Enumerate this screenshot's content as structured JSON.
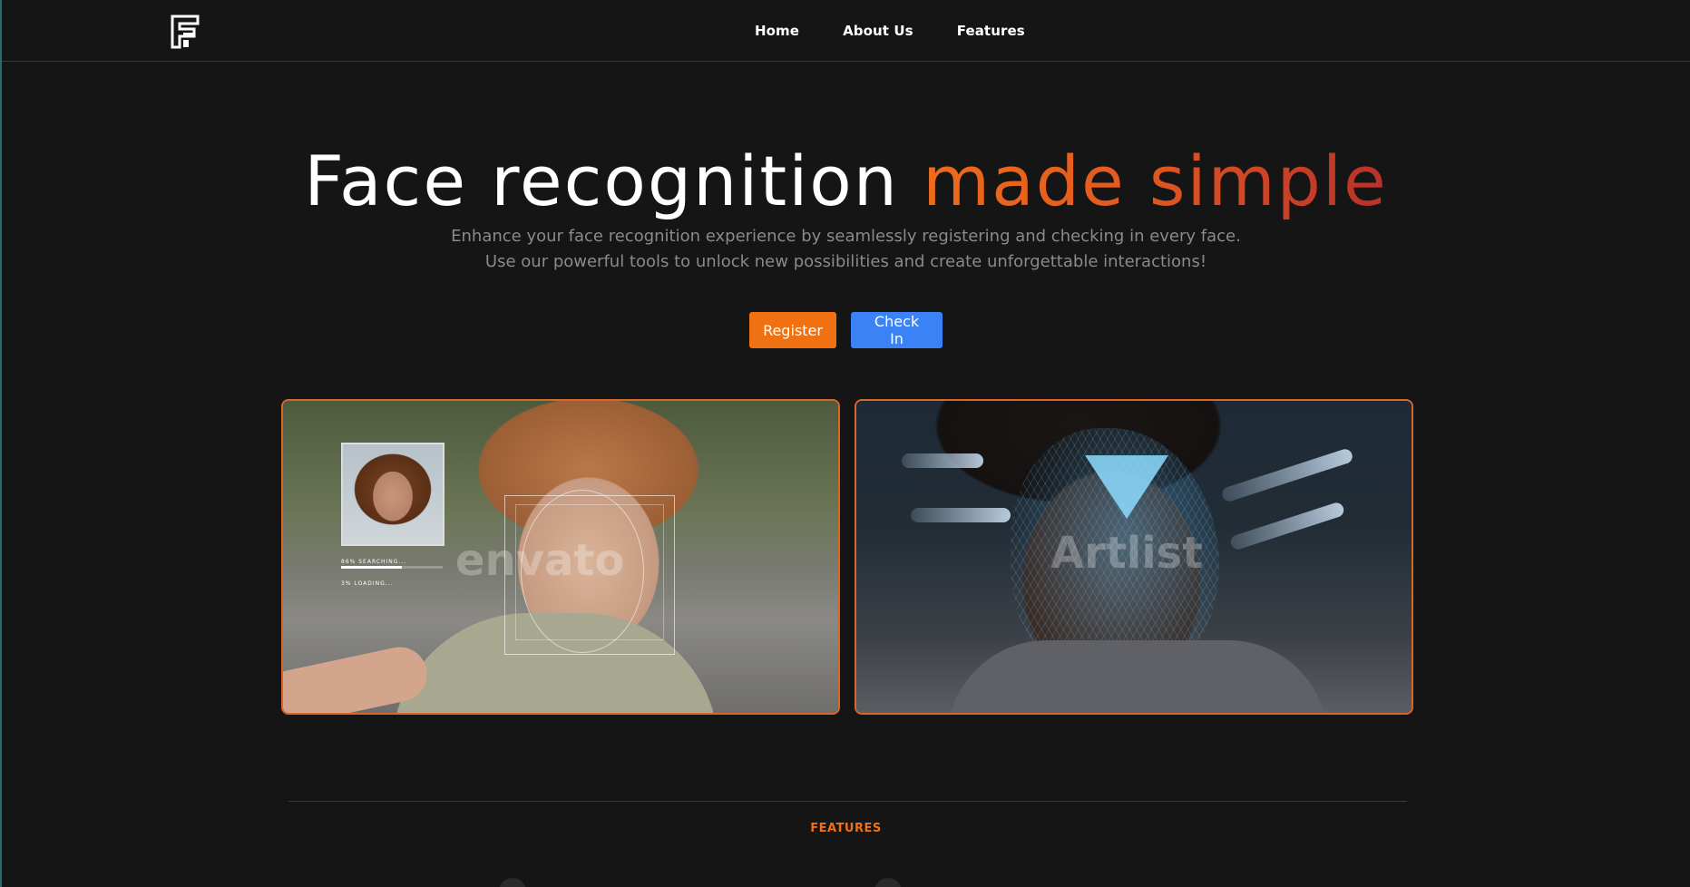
{
  "nav": {
    "items": [
      {
        "label": "Home"
      },
      {
        "label": "About Us"
      },
      {
        "label": "Features"
      }
    ]
  },
  "hero": {
    "title_plain": "Face recognition ",
    "title_accent": "made simple",
    "subtitle_line1": "Enhance your face recognition experience by seamlessly registering and checking in every face.",
    "subtitle_line2": "Use our powerful tools to unlock new possibilities and create unforgettable interactions!",
    "register_label": "Register",
    "checkin_label": "Check In"
  },
  "images": {
    "left": {
      "watermark": "envato",
      "scan_text": "86%   SEARCHING...",
      "load_text": "3%    LOADING...",
      "progress": 0.6
    },
    "right": {
      "watermark": "Artlist"
    }
  },
  "features": {
    "label": "FEATURES"
  },
  "colors": {
    "accent": "#f07112",
    "button_blue": "#3b82f6",
    "background": "#151515"
  }
}
